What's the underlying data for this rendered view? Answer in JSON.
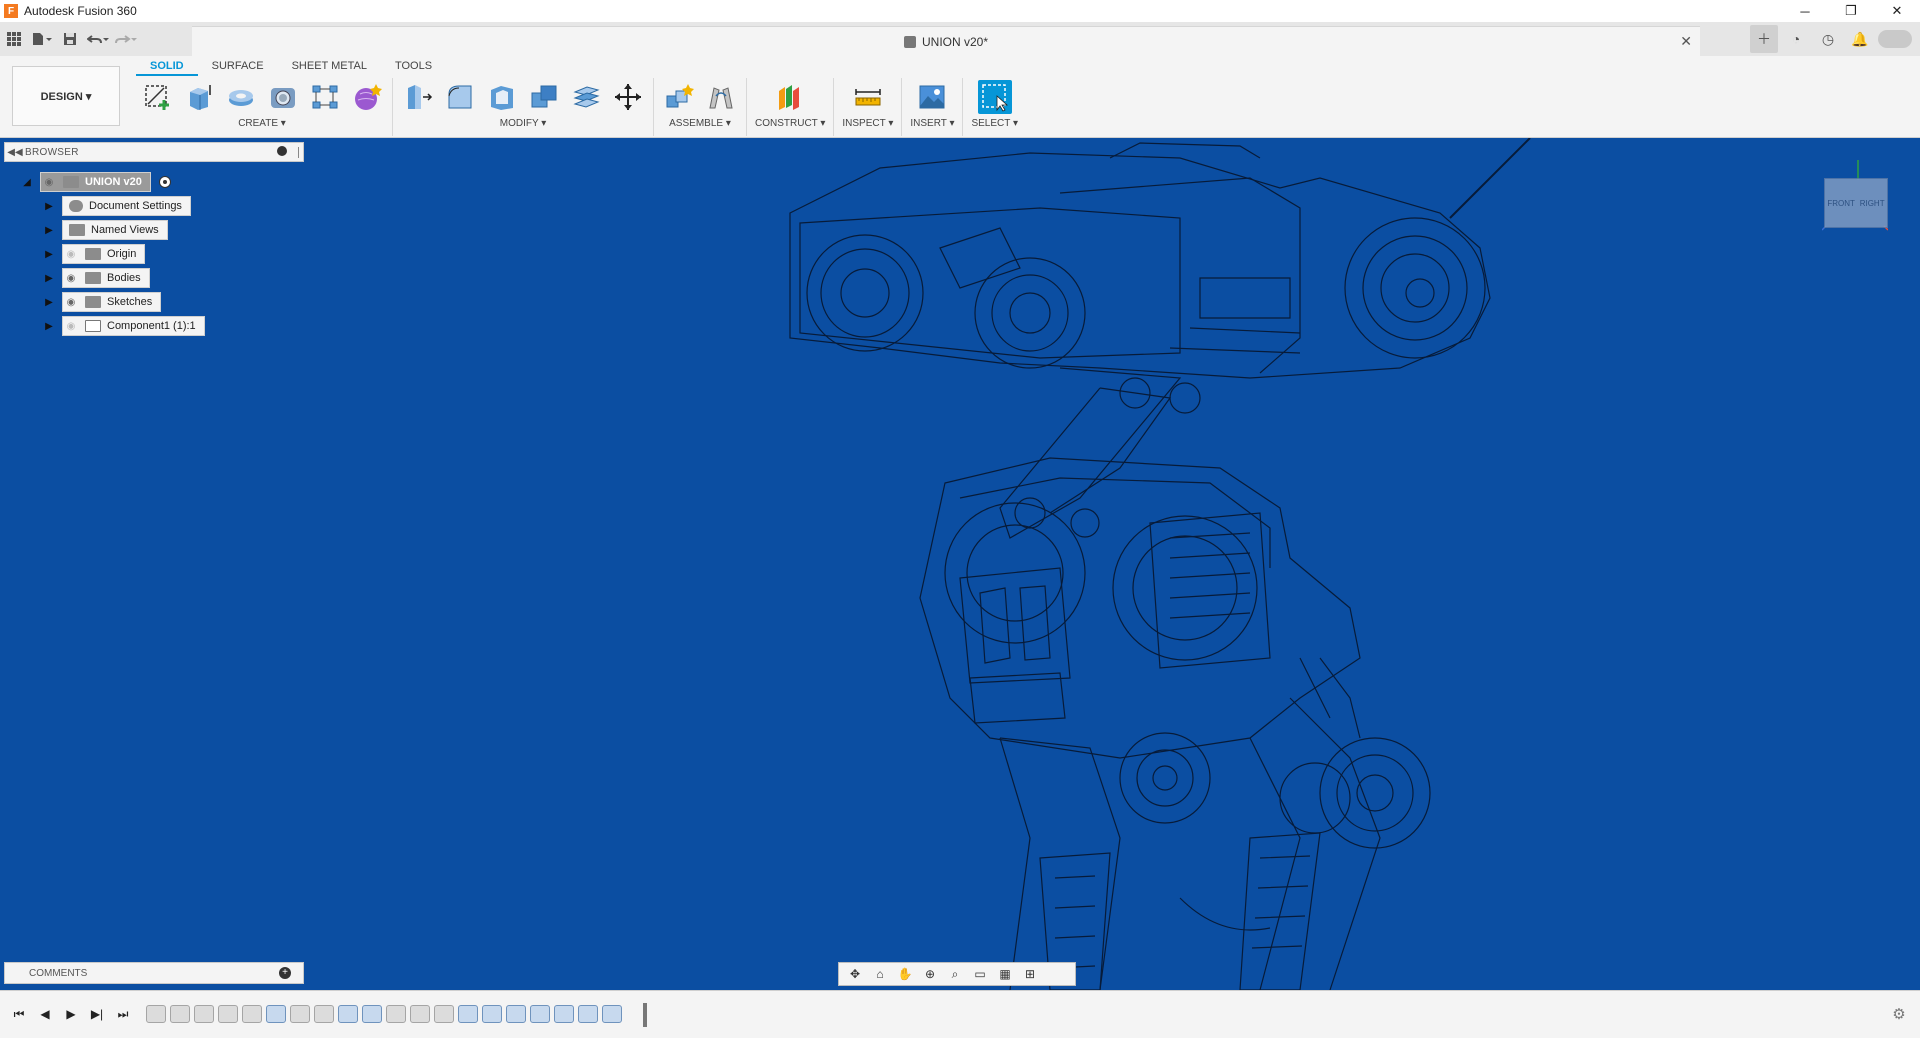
{
  "window": {
    "title": "Autodesk Fusion 360",
    "minimize": "─",
    "restore": "❐",
    "close": "✕"
  },
  "document": {
    "title": "UNION v20*",
    "close": "✕"
  },
  "toolbar": {
    "workspace": "DESIGN ▾",
    "tabs": [
      "SOLID",
      "SURFACE",
      "SHEET METAL",
      "TOOLS"
    ],
    "active_tab": "SOLID",
    "groups": {
      "create": "CREATE ▾",
      "modify": "MODIFY ▾",
      "assemble": "ASSEMBLE ▾",
      "construct": "CONSTRUCT ▾",
      "inspect": "INSPECT ▾",
      "insert": "INSERT ▾",
      "select": "SELECT ▾"
    }
  },
  "browser": {
    "title": "BROWSER",
    "root": "UNION v20",
    "items": [
      {
        "label": "Document Settings",
        "icon": "gear-icon"
      },
      {
        "label": "Named Views",
        "icon": "folder-icon"
      },
      {
        "label": "Origin",
        "icon": "folder-icon"
      },
      {
        "label": "Bodies",
        "icon": "folder-icon"
      },
      {
        "label": "Sketches",
        "icon": "folder-icon"
      },
      {
        "label": "Component1 (1):1",
        "icon": "component-icon"
      }
    ]
  },
  "viewcube": {
    "front": "FRONT",
    "right": "RIGHT"
  },
  "comments": {
    "title": "COMMENTS"
  },
  "colors": {
    "viewport_bg": "#0b4ea2",
    "accent": "#0696d7",
    "model_lines": "#07162e"
  }
}
